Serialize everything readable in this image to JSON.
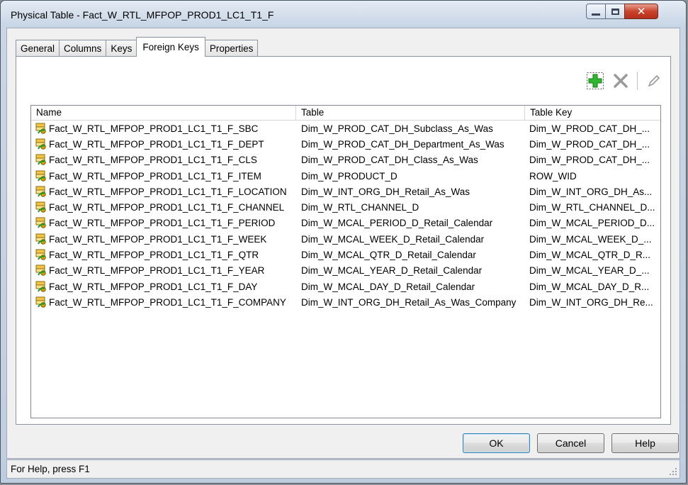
{
  "window": {
    "title": "Physical Table - Fact_W_RTL_MFPOP_PROD1_LC1_T1_F"
  },
  "tabs": [
    {
      "label": "General",
      "active": false
    },
    {
      "label": "Columns",
      "active": false
    },
    {
      "label": "Keys",
      "active": false
    },
    {
      "label": "Foreign Keys",
      "active": true
    },
    {
      "label": "Properties",
      "active": false
    }
  ],
  "toolbar": {
    "add_icon": "add-icon",
    "delete_icon": "delete-icon",
    "edit_icon": "edit-icon"
  },
  "list": {
    "headers": [
      "Name",
      "Table",
      "Table Key"
    ],
    "rows": [
      [
        "Fact_W_RTL_MFPOP_PROD1_LC1_T1_F_SBC",
        "Dim_W_PROD_CAT_DH_Subclass_As_Was",
        "Dim_W_PROD_CAT_DH_..."
      ],
      [
        "Fact_W_RTL_MFPOP_PROD1_LC1_T1_F_DEPT",
        "Dim_W_PROD_CAT_DH_Department_As_Was",
        "Dim_W_PROD_CAT_DH_..."
      ],
      [
        "Fact_W_RTL_MFPOP_PROD1_LC1_T1_F_CLS",
        "Dim_W_PROD_CAT_DH_Class_As_Was",
        "Dim_W_PROD_CAT_DH_..."
      ],
      [
        "Fact_W_RTL_MFPOP_PROD1_LC1_T1_F_ITEM",
        "Dim_W_PRODUCT_D",
        "ROW_WID"
      ],
      [
        "Fact_W_RTL_MFPOP_PROD1_LC1_T1_F_LOCATION",
        "Dim_W_INT_ORG_DH_Retail_As_Was",
        "Dim_W_INT_ORG_DH_As..."
      ],
      [
        "Fact_W_RTL_MFPOP_PROD1_LC1_T1_F_CHANNEL",
        "Dim_W_RTL_CHANNEL_D",
        "Dim_W_RTL_CHANNEL_D..."
      ],
      [
        "Fact_W_RTL_MFPOP_PROD1_LC1_T1_F_PERIOD",
        "Dim_W_MCAL_PERIOD_D_Retail_Calendar",
        "Dim_W_MCAL_PERIOD_D..."
      ],
      [
        "Fact_W_RTL_MFPOP_PROD1_LC1_T1_F_WEEK",
        "Dim_W_MCAL_WEEK_D_Retail_Calendar",
        "Dim_W_MCAL_WEEK_D_..."
      ],
      [
        "Fact_W_RTL_MFPOP_PROD1_LC1_T1_F_QTR",
        "Dim_W_MCAL_QTR_D_Retail_Calendar",
        "Dim_W_MCAL_QTR_D_R..."
      ],
      [
        "Fact_W_RTL_MFPOP_PROD1_LC1_T1_F_YEAR",
        "Dim_W_MCAL_YEAR_D_Retail_Calendar",
        "Dim_W_MCAL_YEAR_D_..."
      ],
      [
        "Fact_W_RTL_MFPOP_PROD1_LC1_T1_F_DAY",
        "Dim_W_MCAL_DAY_D_Retail_Calendar",
        "Dim_W_MCAL_DAY_D_R..."
      ],
      [
        "Fact_W_RTL_MFPOP_PROD1_LC1_T1_F_COMPANY",
        "Dim_W_INT_ORG_DH_Retail_As_Was_Company",
        "Dim_W_INT_ORG_DH_Re..."
      ]
    ],
    "row_icon": "foreign-key-icon"
  },
  "buttons": {
    "ok": "OK",
    "cancel": "Cancel",
    "help": "Help"
  },
  "status": {
    "text": "For Help, press F1"
  }
}
